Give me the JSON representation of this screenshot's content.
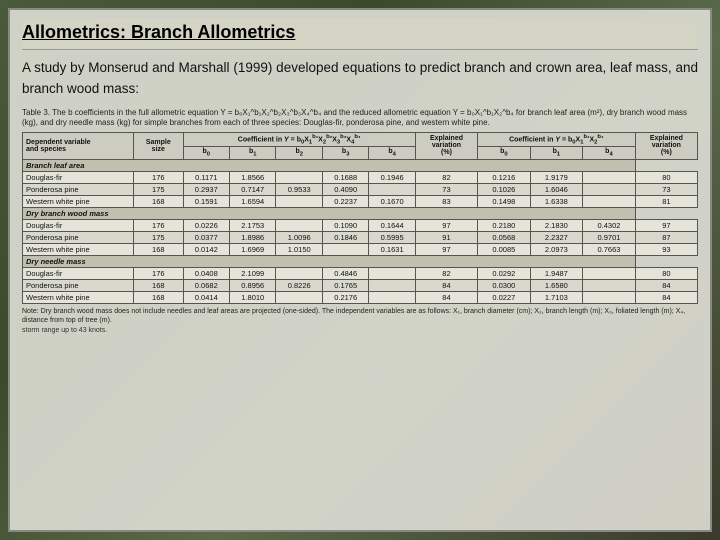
{
  "title": {
    "prefix": "Allometrics:",
    "suffix": " Branch Allometrics"
  },
  "intro": {
    "paragraph": "A  study  by  Monserud  and  Marshall  (1999)  developed equations to predict branch and crown area, leaf mass, and branch wood mass:"
  },
  "table": {
    "caption": "Table 3. The b coefficients in the full allometric equation Y = b₀X₁^b₁X₂^b₂X₃^b₃X₄^b₄ and the reduced allometric equation Y = b₀X₁^b₁X₂^b₄ for branch leaf area (m²), dry branch wood mass (kg), and dry needle mass (kg) for simple branches from each of three species: Douglas-fir, ponderosa pine, and western white pine.",
    "headers": {
      "col1": "Dependent variable and species",
      "col2": "Sample size",
      "full_eq": "Coefficient in Y = b₀X₁^b₁X₂^b₂X₃^b₃X₄^b₄",
      "full_cols": [
        "b₀",
        "b₁",
        "b₂",
        "b₃",
        "b₄"
      ],
      "exp_var1": "Explained variation (%)",
      "red_eq": "Coefficient in Y = b₀X₁^b₁X₂^b₄",
      "red_cols": [
        "b₀",
        "b₁",
        "b₄"
      ],
      "exp_var2": "Explained variation (%)"
    },
    "sections": [
      {
        "section_title": "Branch leaf area",
        "rows": [
          {
            "species": "Douglas-fir",
            "n": 176,
            "b0": "0.1171",
            "b1": "1.8566",
            "b2": "",
            "b3": "0.1688",
            "b4": "0.1946",
            "ev1": "82",
            "rb0": "0.1216",
            "rb1": "1.9179",
            "rb4": "",
            "ev2": "80"
          },
          {
            "species": "Ponderosa pine",
            "n": 175,
            "b0": "0.2937",
            "b1": "0.7147",
            "b2": "0.9533",
            "b3": "0.4090",
            "b4": "",
            "ev1": "73",
            "rb0": "0.1026",
            "rb1": "1.6046",
            "rb4": "",
            "ev2": "73"
          },
          {
            "species": "Western white pine",
            "n": 168,
            "b0": "0.1591",
            "b1": "1.6594",
            "b2": "",
            "b3": "0.2237",
            "b4": "0.1670",
            "ev1": "83",
            "rb0": "0.1498",
            "rb1": "1.6338",
            "rb4": "",
            "ev2": "81"
          }
        ]
      },
      {
        "section_title": "Dry branch wood mass",
        "rows": [
          {
            "species": "Douglas-fir",
            "n": 176,
            "b0": "0.0226",
            "b1": "2.1753",
            "b2": "",
            "b3": "0.1090",
            "b4": "0.1644",
            "ev1": "97",
            "rb0": "0.2180",
            "rb1": "2.1830",
            "rb4": "0.4302",
            "ev2": "97"
          },
          {
            "species": "Ponderosa pine",
            "n": 175,
            "b0": "0.0377",
            "b1": "1.8986",
            "b2": "1.0096",
            "b3": "0.1846",
            "b4": "0.5995",
            "ev1": "91",
            "rb0": "0.0568",
            "rb1": "2.2327",
            "rb4": "0.9701",
            "ev2": "87"
          },
          {
            "species": "Western white pine",
            "n": 168,
            "b0": "0.0142",
            "b1": "1.6969",
            "b2": "1.0150",
            "b3": "",
            "b4": "0.1631",
            "ev1": "97",
            "rb0": "0.0085",
            "rb1": "2.0973",
            "rb4": "0.7663",
            "ev2": "93"
          }
        ]
      },
      {
        "section_title": "Dry needle mass",
        "rows": [
          {
            "species": "Douglas-fir",
            "n": 176,
            "b0": "0.0408",
            "b1": "2.1099",
            "b2": "",
            "b3": "0.4846",
            "b4": "",
            "ev1": "82",
            "rb0": "0.0292",
            "rb1": "1.9487",
            "rb4": "",
            "ev2": "80"
          },
          {
            "species": "Ponderosa pine",
            "n": 168,
            "b0": "0.0682",
            "b1": "0.8956",
            "b2": "0.8226",
            "b3": "0.1765",
            "b4": "",
            "ev1": "84",
            "rb0": "0.0300",
            "rb1": "1.6580",
            "rb4": "",
            "ev2": "84"
          },
          {
            "species": "Western white pine",
            "n": 168,
            "b0": "0.0414",
            "b1": "1.8010",
            "b2": "",
            "b3": "0.2176",
            "b4": "",
            "ev1": "84",
            "rb0": "0.0227",
            "rb1": "1.7103",
            "rb4": "",
            "ev2": "84"
          }
        ]
      }
    ],
    "note": "Note: Dry branch wood mass does not include needles and leaf areas are projected (one-sided). The independent variables are as follows: X₁, branch diameter (cm); X₂, branch length (m); X₃, foliated length (m); X₄, distance from top of tree (m)."
  },
  "bottom_note": "storm range up to 43 knots."
}
